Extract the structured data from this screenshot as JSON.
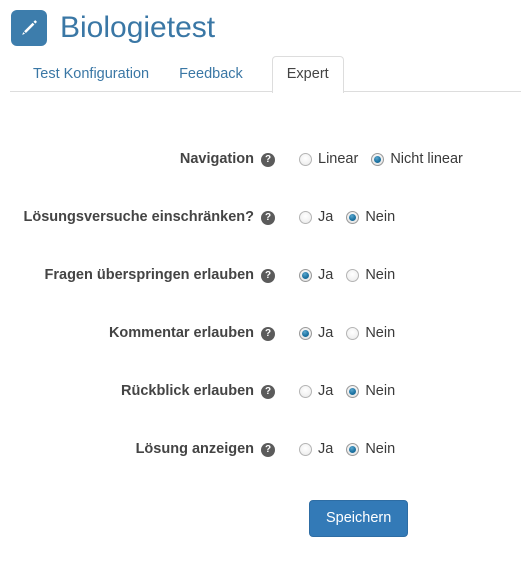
{
  "header": {
    "icon": "pencil-icon",
    "title": "Biologietest",
    "icon_color": "#3d7dac",
    "title_color": "#3a77a5"
  },
  "tabs": [
    {
      "label": "Test Konfiguration",
      "active": false
    },
    {
      "label": "Feedback",
      "active": false
    },
    {
      "label": "Expert",
      "active": true
    }
  ],
  "form": {
    "help_glyph": "?",
    "rows": [
      {
        "label": "Navigation",
        "help": "help-icon",
        "options": [
          {
            "label": "Linear",
            "checked": false
          },
          {
            "label": "Nicht linear",
            "checked": true
          }
        ]
      },
      {
        "label": "Lösungsversuche einschränken?",
        "help": "help-icon",
        "options": [
          {
            "label": "Ja",
            "checked": false
          },
          {
            "label": "Nein",
            "checked": true
          }
        ]
      },
      {
        "label": "Fragen überspringen erlauben",
        "help": "help-icon",
        "options": [
          {
            "label": "Ja",
            "checked": true
          },
          {
            "label": "Nein",
            "checked": false
          }
        ]
      },
      {
        "label": "Kommentar erlauben",
        "help": "help-icon",
        "options": [
          {
            "label": "Ja",
            "checked": true
          },
          {
            "label": "Nein",
            "checked": false
          }
        ]
      },
      {
        "label": "Rückblick erlauben",
        "help": "help-icon",
        "options": [
          {
            "label": "Ja",
            "checked": false
          },
          {
            "label": "Nein",
            "checked": true
          }
        ]
      },
      {
        "label": "Lösung anzeigen",
        "help": "help-icon",
        "options": [
          {
            "label": "Ja",
            "checked": false
          },
          {
            "label": "Nein",
            "checked": true
          }
        ]
      }
    ],
    "submit_label": "Speichern",
    "submit_color": "#337ab7",
    "radio_selected_color": "#1e74a3"
  }
}
